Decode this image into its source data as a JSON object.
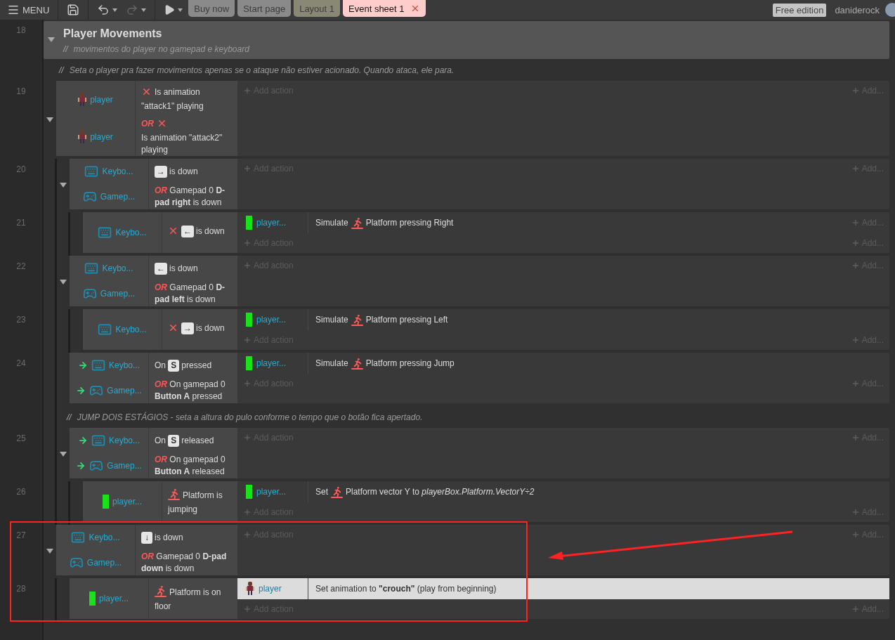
{
  "toolbar": {
    "menu_label": "MENU",
    "tabs": [
      {
        "label": "Buy now",
        "selected": false,
        "color": "#8a8a8a"
      },
      {
        "label": "Start page",
        "selected": false,
        "color": "#8a8a8a"
      },
      {
        "label": "Layout 1",
        "selected": false,
        "color": "#8b8775"
      },
      {
        "label": "Event sheet 1",
        "selected": true,
        "color": "#ffcccc"
      }
    ],
    "edition": "Free edition",
    "user": "daniderock"
  },
  "group": {
    "line": "18",
    "title": "Player Movements",
    "expanded": true,
    "comment": {
      "marker": "//",
      "text": "movimentos do player no gamepad e keyboard"
    },
    "children": [
      {
        "kind": "comment",
        "marker": "//",
        "text": "Seta o player pra fazer movimentos apenas se o ataque não estiver acionado. Quando ataca, ele para."
      },
      {
        "kind": "event",
        "line": "19",
        "expanded": true,
        "highlighted": false,
        "add_action": "Add action",
        "add_more": "Add...",
        "conditions": [
          {
            "object": "player",
            "kind": "sprite",
            "trigger": false,
            "inverted": true,
            "behavior": false,
            "text": "Is animation \"attack1\" playing"
          },
          {
            "object": "player",
            "kind": "sprite",
            "trigger": false,
            "inverted": true,
            "behavior": false,
            "or": "OR",
            "text": "Is animation \"attack2\" playing"
          }
        ],
        "children": [
          {
            "kind": "event",
            "line": "20",
            "expanded": true,
            "highlighted": false,
            "add_action": "Add action",
            "add_more": "Add...",
            "conditions": [
              {
                "object": "Keybo...",
                "kind": "keyboard",
                "trigger": false,
                "inverted": false,
                "behavior": false,
                "key": "→",
                "text": "is down"
              },
              {
                "object": "Gamep...",
                "kind": "gamepad",
                "trigger": false,
                "inverted": false,
                "behavior": false,
                "text": "*OR* Gamepad 0 **D-pad right** is down"
              }
            ],
            "children": [
              {
                "kind": "event",
                "line": "21",
                "highlighted": false,
                "add_action": "Add action",
                "add_more": "Add...",
                "conditions": [
                  {
                    "object": "Keybo...",
                    "kind": "keyboard",
                    "trigger": false,
                    "inverted": true,
                    "behavior": false,
                    "key": "←",
                    "text": "is down"
                  }
                ],
                "actions": [
                  {
                    "object": "player...",
                    "kind": "box",
                    "verb": "Simulate",
                    "behavior": true,
                    "text": "Platform pressing Right",
                    "selected": false,
                    "more": "Add..."
                  }
                ]
              }
            ]
          },
          {
            "kind": "event",
            "line": "22",
            "expanded": true,
            "highlighted": false,
            "add_action": "Add action",
            "add_more": "Add...",
            "conditions": [
              {
                "object": "Keybo...",
                "kind": "keyboard",
                "trigger": false,
                "inverted": false,
                "behavior": false,
                "key": "←",
                "text": "is down"
              },
              {
                "object": "Gamep...",
                "kind": "gamepad",
                "trigger": false,
                "inverted": false,
                "behavior": false,
                "text": "*OR* Gamepad 0 **D-pad left** is down"
              }
            ],
            "children": [
              {
                "kind": "event",
                "line": "23",
                "highlighted": false,
                "add_action": "Add action",
                "add_more": "Add...",
                "conditions": [
                  {
                    "object": "Keybo...",
                    "kind": "keyboard",
                    "trigger": false,
                    "inverted": true,
                    "behavior": false,
                    "key": "→",
                    "text": "is down"
                  }
                ],
                "actions": [
                  {
                    "object": "player...",
                    "kind": "box",
                    "verb": "Simulate",
                    "behavior": true,
                    "text": "Platform pressing Left",
                    "selected": false
                  }
                ]
              }
            ]
          },
          {
            "kind": "event",
            "line": "24",
            "highlighted": false,
            "add_action": "Add action",
            "add_more": "Add...",
            "conditions": [
              {
                "object": "Keybo...",
                "kind": "keyboard",
                "trigger": true,
                "inverted": false,
                "behavior": false,
                "pre": "On",
                "key": "S",
                "text": "pressed"
              },
              {
                "object": "Gamep...",
                "kind": "gamepad",
                "trigger": true,
                "inverted": false,
                "behavior": false,
                "text": "*OR* On gamepad 0 **Button A** pressed"
              }
            ],
            "actions": [
              {
                "object": "player...",
                "kind": "box",
                "verb": "Simulate",
                "behavior": true,
                "text": "Platform pressing Jump",
                "selected": false
              }
            ]
          },
          {
            "kind": "comment",
            "marker": "//",
            "text": "JUMP DOIS ESTÁGIOS - seta a altura do pulo conforme o tempo que o botão fica apertado."
          },
          {
            "kind": "event",
            "line": "25",
            "expanded": true,
            "highlighted": false,
            "add_action": "Add action",
            "add_more": "Add...",
            "conditions": [
              {
                "object": "Keybo...",
                "kind": "keyboard",
                "trigger": true,
                "inverted": false,
                "behavior": false,
                "pre": "On",
                "key": "S",
                "text": "released"
              },
              {
                "object": "Gamep...",
                "kind": "gamepad",
                "trigger": true,
                "inverted": false,
                "behavior": false,
                "text": "*OR* On gamepad 0 **Button A** released"
              }
            ],
            "children": [
              {
                "kind": "event",
                "line": "26",
                "highlighted": false,
                "add_action": "Add action",
                "add_more": "Add...",
                "conditions": [
                  {
                    "object": "player...",
                    "kind": "box",
                    "trigger": false,
                    "inverted": false,
                    "behavior": true,
                    "text": "Platform is jumping"
                  }
                ],
                "actions": [
                  {
                    "object": "player...",
                    "kind": "box",
                    "verb": "Set",
                    "behavior": true,
                    "text": "Platform vector Y to *playerBox.Platform.VectorY÷2*",
                    "selected": false
                  }
                ]
              }
            ]
          }
        ]
      },
      {
        "kind": "event",
        "line": "27",
        "expanded": true,
        "highlighted": true,
        "add_action": "Add action",
        "add_more": "Add...",
        "conditions": [
          {
            "object": "Keybo...",
            "kind": "keyboard",
            "trigger": false,
            "inverted": false,
            "behavior": false,
            "key": "↓",
            "text": "is down"
          },
          {
            "object": "Gamep...",
            "kind": "gamepad",
            "trigger": false,
            "inverted": false,
            "behavior": false,
            "text": "*OR* Gamepad 0 **D-pad down** is down"
          }
        ],
        "children": [
          {
            "kind": "event",
            "line": "28",
            "highlighted": false,
            "add_action": "Add action",
            "add_more": "Add...",
            "conditions": [
              {
                "object": "player...",
                "kind": "box",
                "trigger": false,
                "inverted": false,
                "behavior": true,
                "text": "Platform is on floor"
              }
            ],
            "actions": [
              {
                "object": "player",
                "kind": "sprite",
                "behavior": false,
                "text": "Set animation to **\"crouch\"** (play from beginning)",
                "selected": true
              }
            ]
          }
        ]
      }
    ]
  }
}
